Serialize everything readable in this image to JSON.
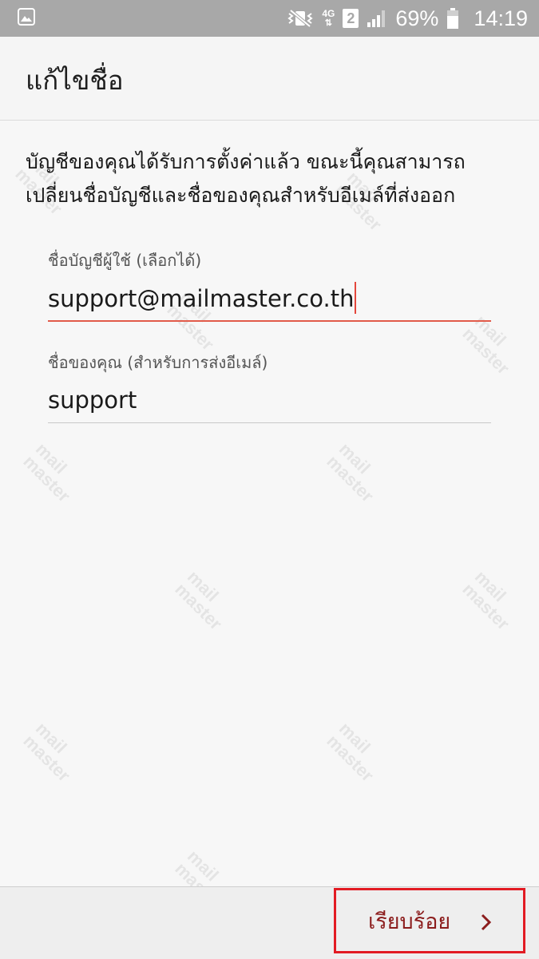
{
  "status_bar": {
    "network": "4G",
    "sim": "2",
    "battery": "69%",
    "time": "14:19"
  },
  "header": {
    "title": "แก้ไขชื่อ"
  },
  "description": "บัญชีของคุณได้รับการตั้งค่าแล้ว ขณะนี้คุณสามารถเปลี่ยนชื่อบัญชีและชื่อของคุณสำหรับอีเมล์ที่ส่งออก",
  "fields": {
    "account_name": {
      "label": "ชื่อบัญชีผู้ใช้ (เลือกได้)",
      "value": "support@mailmaster.co.th"
    },
    "your_name": {
      "label": "ชื่อของคุณ (สำหรับการส่งอีเมล์)",
      "value": "support"
    }
  },
  "footer": {
    "done_label": "เรียบร้อย"
  },
  "watermark": {
    "line1": "mail",
    "line2": "master"
  },
  "colors": {
    "accent": "#e25b4a",
    "highlight_border": "#e21b23",
    "button_text": "#8c1d1d"
  }
}
